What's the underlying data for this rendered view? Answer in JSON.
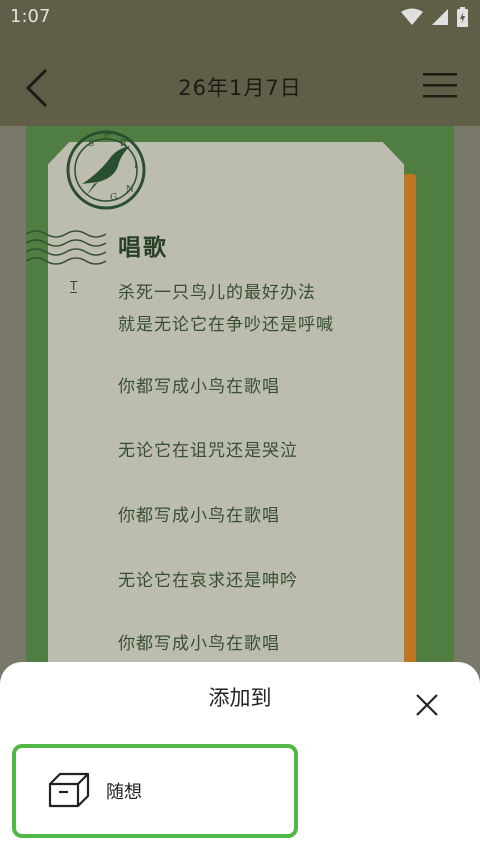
{
  "status_bar": {
    "time": "1:07",
    "icons": [
      "wifi-icon",
      "signal-icon",
      "battery-charging-icon"
    ]
  },
  "app_bar": {
    "title": "26年1月7日",
    "icons": [
      "back-chevron-icon",
      "menu-icon"
    ]
  },
  "poem": {
    "title": "唱歌",
    "mark": "T",
    "lines": [
      "杀死一只鸟儿的最好办法",
      "就是无论它在争吵还是呼喊",
      "你都写成小鸟在歌唱",
      "无论它在诅咒还是哭泣",
      "你都写成小鸟在歌唱",
      "无论它在哀求还是呻吟",
      "你都写成小鸟在歌唱"
    ]
  },
  "stamp": {
    "letters": [
      "S",
      "P",
      "R",
      "I",
      "N",
      "G"
    ]
  },
  "sheet": {
    "title": "添加到",
    "option": {
      "label": "随想",
      "icon": "box-icon"
    }
  },
  "colors": {
    "app_bar": "#6f6b52",
    "board": "#5a8f4c",
    "paper": "#d8d8c8",
    "accent_orange": "#d9862a",
    "selection": "#52b747"
  }
}
